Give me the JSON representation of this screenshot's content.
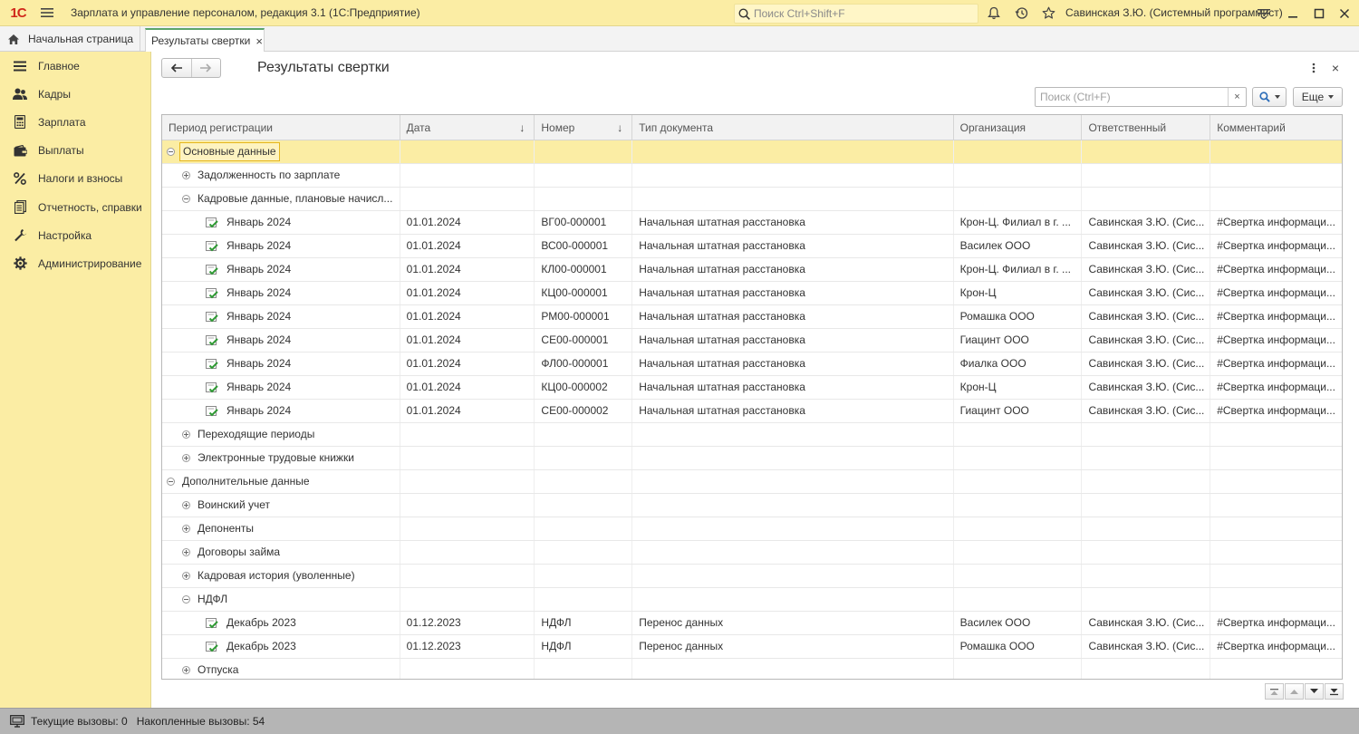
{
  "app": {
    "logo": "1С",
    "title": "Зарплата и управление персоналом, редакция 3.1  (1С:Предприятие)",
    "search_placeholder": "Поиск Ctrl+Shift+F",
    "user": "Савинская З.Ю. (Системный программист)"
  },
  "tabs": {
    "home": "Начальная страница",
    "active": "Результаты свертки",
    "close": "×"
  },
  "sidebar": {
    "items": [
      {
        "label": "Главное",
        "icon": "menu-icon"
      },
      {
        "label": "Кадры",
        "icon": "people-icon"
      },
      {
        "label": "Зарплата",
        "icon": "calculator-icon"
      },
      {
        "label": "Выплаты",
        "icon": "wallet-icon"
      },
      {
        "label": "Налоги и взносы",
        "icon": "percent-icon"
      },
      {
        "label": "Отчетность, справки",
        "icon": "reports-icon"
      },
      {
        "label": "Настройка",
        "icon": "wrench-icon"
      },
      {
        "label": "Администрирование",
        "icon": "gear-icon"
      }
    ]
  },
  "form": {
    "title": "Результаты свертки",
    "search_placeholder": "Поиск (Ctrl+F)",
    "clear": "×",
    "more_label": "Еще",
    "close": "×"
  },
  "table": {
    "columns": [
      "Период регистрации",
      "Дата",
      "Номер",
      "Тип документа",
      "Организация",
      "Ответственный",
      "Комментарий"
    ],
    "sort_mark": "↓",
    "rows": [
      {
        "level": 0,
        "toggle": "minus",
        "doc": false,
        "selected": true,
        "cells": [
          "Основные данные",
          "",
          "",
          "",
          "",
          "",
          ""
        ]
      },
      {
        "level": 1,
        "toggle": "plus",
        "doc": false,
        "selected": false,
        "cells": [
          "Задолженность по зарплате",
          "",
          "",
          "",
          "",
          "",
          ""
        ]
      },
      {
        "level": 1,
        "toggle": "minus",
        "doc": false,
        "selected": false,
        "cells": [
          "Кадровые данные, плановые начисл...",
          "",
          "",
          "",
          "",
          "",
          ""
        ]
      },
      {
        "level": 2,
        "toggle": "",
        "doc": true,
        "selected": false,
        "cells": [
          "Январь 2024",
          "01.01.2024",
          "ВГ00-000001",
          "Начальная штатная расстановка",
          "Крон-Ц. Филиал в г. ...",
          "Савинская З.Ю. (Сис...",
          "#Свертка информаци..."
        ]
      },
      {
        "level": 2,
        "toggle": "",
        "doc": true,
        "selected": false,
        "cells": [
          "Январь 2024",
          "01.01.2024",
          "ВС00-000001",
          "Начальная штатная расстановка",
          "Василек ООО",
          "Савинская З.Ю. (Сис...",
          "#Свертка информаци..."
        ]
      },
      {
        "level": 2,
        "toggle": "",
        "doc": true,
        "selected": false,
        "cells": [
          "Январь 2024",
          "01.01.2024",
          "КЛ00-000001",
          "Начальная штатная расстановка",
          "Крон-Ц. Филиал в г. ...",
          "Савинская З.Ю. (Сис...",
          "#Свертка информаци..."
        ]
      },
      {
        "level": 2,
        "toggle": "",
        "doc": true,
        "selected": false,
        "cells": [
          "Январь 2024",
          "01.01.2024",
          "КЦ00-000001",
          "Начальная штатная расстановка",
          "Крон-Ц",
          "Савинская З.Ю. (Сис...",
          "#Свертка информаци..."
        ]
      },
      {
        "level": 2,
        "toggle": "",
        "doc": true,
        "selected": false,
        "cells": [
          "Январь 2024",
          "01.01.2024",
          "РМ00-000001",
          "Начальная штатная расстановка",
          "Ромашка ООО",
          "Савинская З.Ю. (Сис...",
          "#Свертка информаци..."
        ]
      },
      {
        "level": 2,
        "toggle": "",
        "doc": true,
        "selected": false,
        "cells": [
          "Январь 2024",
          "01.01.2024",
          "СЕ00-000001",
          "Начальная штатная расстановка",
          "Гиацинт ООО",
          "Савинская З.Ю. (Сис...",
          "#Свертка информаци..."
        ]
      },
      {
        "level": 2,
        "toggle": "",
        "doc": true,
        "selected": false,
        "cells": [
          "Январь 2024",
          "01.01.2024",
          "ФЛ00-000001",
          "Начальная штатная расстановка",
          "Фиалка ООО",
          "Савинская З.Ю. (Сис...",
          "#Свертка информаци..."
        ]
      },
      {
        "level": 2,
        "toggle": "",
        "doc": true,
        "selected": false,
        "cells": [
          "Январь 2024",
          "01.01.2024",
          "КЦ00-000002",
          "Начальная штатная расстановка",
          "Крон-Ц",
          "Савинская З.Ю. (Сис...",
          "#Свертка информаци..."
        ]
      },
      {
        "level": 2,
        "toggle": "",
        "doc": true,
        "selected": false,
        "cells": [
          "Январь 2024",
          "01.01.2024",
          "СЕ00-000002",
          "Начальная штатная расстановка",
          "Гиацинт ООО",
          "Савинская З.Ю. (Сис...",
          "#Свертка информаци..."
        ]
      },
      {
        "level": 1,
        "toggle": "plus",
        "doc": false,
        "selected": false,
        "cells": [
          "Переходящие периоды",
          "",
          "",
          "",
          "",
          "",
          ""
        ]
      },
      {
        "level": 1,
        "toggle": "plus",
        "doc": false,
        "selected": false,
        "cells": [
          "Электронные трудовые книжки",
          "",
          "",
          "",
          "",
          "",
          ""
        ]
      },
      {
        "level": 0,
        "toggle": "minus",
        "doc": false,
        "selected": false,
        "cells": [
          "Дополнительные данные",
          "",
          "",
          "",
          "",
          "",
          ""
        ]
      },
      {
        "level": 1,
        "toggle": "plus",
        "doc": false,
        "selected": false,
        "cells": [
          "Воинский учет",
          "",
          "",
          "",
          "",
          "",
          ""
        ]
      },
      {
        "level": 1,
        "toggle": "plus",
        "doc": false,
        "selected": false,
        "cells": [
          "Депоненты",
          "",
          "",
          "",
          "",
          "",
          ""
        ]
      },
      {
        "level": 1,
        "toggle": "plus",
        "doc": false,
        "selected": false,
        "cells": [
          "Договоры займа",
          "",
          "",
          "",
          "",
          "",
          ""
        ]
      },
      {
        "level": 1,
        "toggle": "plus",
        "doc": false,
        "selected": false,
        "cells": [
          "Кадровая история (уволенные)",
          "",
          "",
          "",
          "",
          "",
          ""
        ]
      },
      {
        "level": 1,
        "toggle": "minus",
        "doc": false,
        "selected": false,
        "cells": [
          "НДФЛ",
          "",
          "",
          "",
          "",
          "",
          ""
        ]
      },
      {
        "level": 2,
        "toggle": "",
        "doc": true,
        "selected": false,
        "cells": [
          "Декабрь 2023",
          "01.12.2023",
          "НДФЛ",
          "Перенос данных",
          "Василек ООО",
          "Савинская З.Ю. (Сис...",
          "#Свертка информаци..."
        ]
      },
      {
        "level": 2,
        "toggle": "",
        "doc": true,
        "selected": false,
        "cells": [
          "Декабрь 2023",
          "01.12.2023",
          "НДФЛ",
          "Перенос данных",
          "Ромашка ООО",
          "Савинская З.Ю. (Сис...",
          "#Свертка информаци..."
        ]
      },
      {
        "level": 1,
        "toggle": "plus",
        "doc": false,
        "selected": false,
        "cells": [
          "Отпуска",
          "",
          "",
          "",
          "",
          "",
          ""
        ]
      }
    ]
  },
  "statusbar": {
    "current_calls": "Текущие вызовы: 0",
    "accumulated_calls": "Накопленные вызовы: 54"
  },
  "colors": {
    "accent_yellow": "#fbeda4",
    "selection": "#fbeda4",
    "tab_accent": "#5aa46a",
    "logo_red": "#d0281b"
  }
}
